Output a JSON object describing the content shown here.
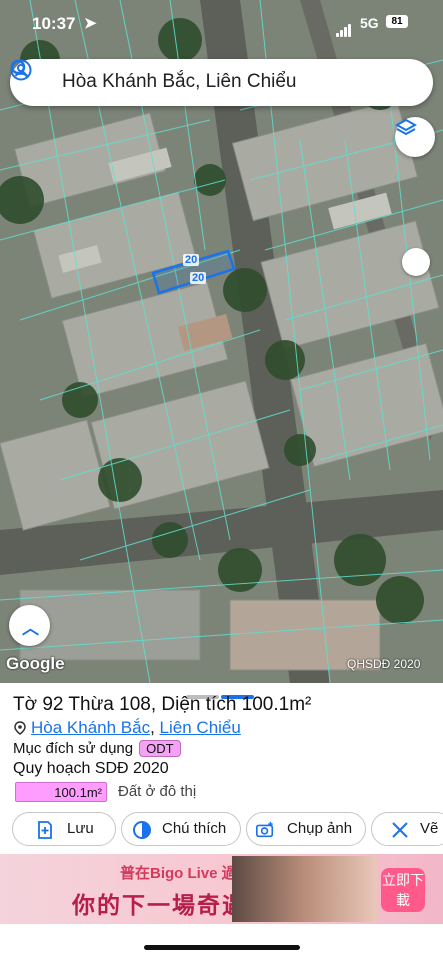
{
  "status_bar": {
    "time": "10:37",
    "network": "5G",
    "battery": "81"
  },
  "search": {
    "query": "Hòa Khánh Bắc, Liên Chiểu"
  },
  "map": {
    "parcel_labels": [
      "20",
      "20"
    ],
    "google_logo": "Google",
    "credit": "QHSDĐ 2020"
  },
  "sheet": {
    "title": "Tờ 92 Thừa 108, Diện tích 100.1m²",
    "address_ward": "Hòa Khánh Bắc",
    "address_sep": ", ",
    "address_district": "Liên Chiểu",
    "purpose_label": "Mục đích sử dụng",
    "purpose_code": "ODT",
    "plan_label": "Quy hoạch SDĐ 2020",
    "area_value": "100.1m²",
    "area_desc": "Đất ở đô thị",
    "actions": [
      {
        "label": "Lưu",
        "icon": "bookmark-add-icon"
      },
      {
        "label": "Chú thích",
        "icon": "legend-icon"
      },
      {
        "label": "Chụp ảnh",
        "icon": "camera-icon"
      },
      {
        "label": "Vẽ",
        "icon": "draw-icon"
      }
    ]
  },
  "ad": {
    "line1": "普在Bigo Live 過見筷?",
    "line2": "你的下一場奇遇..",
    "cta": "立即下載"
  },
  "colors": {
    "accent": "#1a73e8",
    "badge": "#f4a3f4",
    "area_bar": "#ff9dff",
    "parcel_line": "#5fe0d0"
  }
}
